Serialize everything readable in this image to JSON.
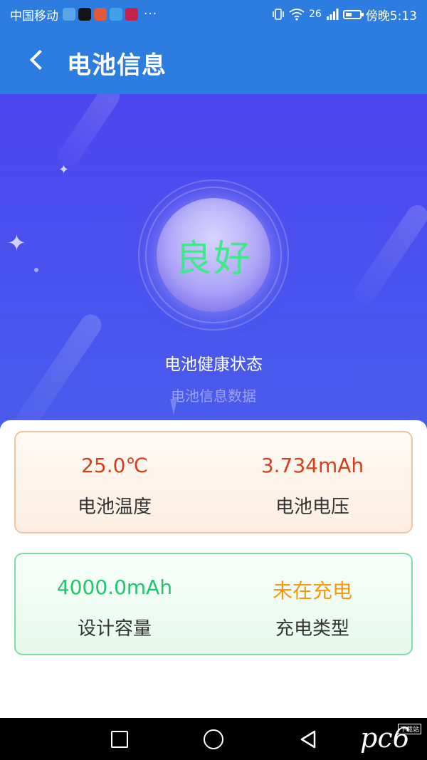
{
  "status_bar": {
    "carrier": "中国移动",
    "more": "···",
    "signal_tag": "26",
    "time": "傍晚5:13",
    "battery_level": 0.45,
    "app_icons": [
      {
        "name": "browser-app-icon",
        "color": "#5aa7e8"
      },
      {
        "name": "tiktok-app-icon",
        "color": "#151515"
      },
      {
        "name": "video-app-icon",
        "color": "#e05a3c"
      },
      {
        "name": "weather-app-icon",
        "color": "#3fa2e6"
      },
      {
        "name": "notice-app-icon",
        "color": "#c3224a"
      }
    ]
  },
  "header": {
    "title": "电池信息",
    "back_icon": "chevron-left-icon"
  },
  "hero": {
    "status": "良好",
    "health_label": "电池健康状态",
    "data_label": "电池信息数据"
  },
  "cards": [
    {
      "style": "orange",
      "cells": [
        {
          "value": "25.0℃",
          "label": "电池温度",
          "color": "#d2401e"
        },
        {
          "value": "3.734mAh",
          "label": "电池电压",
          "color": "#d2401e"
        }
      ]
    },
    {
      "style": "green",
      "cells": [
        {
          "value": "4000.0mAh",
          "label": "设计容量",
          "color": "#25c36e"
        },
        {
          "value": "未在充电",
          "label": "充电类型",
          "color": "#f29a12"
        }
      ]
    }
  ],
  "nav": {
    "watermark": "pc6",
    "watermark_sub": "下载站"
  },
  "colors": {
    "header_bg": "#2d7ce0",
    "hero_bg": "#4b4dee",
    "orb_text": "#3fe88a"
  }
}
